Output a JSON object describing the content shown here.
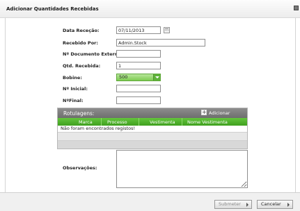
{
  "dialog": {
    "title": "Adicionar Quantidades Recebidas"
  },
  "form": {
    "data_rececao": {
      "label": "Data Receção:",
      "value": "07/11/2013"
    },
    "recebido_por": {
      "label": "Recebido Por:",
      "value": "Admin.Stock"
    },
    "documento_externo": {
      "label": "Nº Documento Externo:",
      "value": ""
    },
    "qtd_recebida": {
      "label": "Qtd. Recebida:",
      "value": "1"
    },
    "bobine": {
      "label": "Bobine:",
      "value": "500"
    },
    "n_inicial": {
      "label": "Nº Inicial:",
      "value": ""
    },
    "n_final": {
      "label": "NºFinal:",
      "value": ""
    },
    "observacoes": {
      "label": "Observações:",
      "value": ""
    }
  },
  "rotulagens": {
    "title": "Rotulagens:",
    "add_label": "Adicionar",
    "columns": [
      "Marca",
      "Processo",
      "Vestimenta",
      "Nome Vestimenta"
    ],
    "empty_message": "Não foram encontrados registos!"
  },
  "footer": {
    "submit_label": "Submeter",
    "cancel_label": "Cancelar"
  },
  "icons": {
    "calendar": "calendar-icon",
    "close": "close-icon",
    "add": "plus-icon",
    "dropdown": "chevron-down-icon",
    "button_arrow": "arrow-right-icon"
  },
  "colors": {
    "accent_green": "#4fb02a",
    "panel_header_gray": "#7d7d7d"
  }
}
